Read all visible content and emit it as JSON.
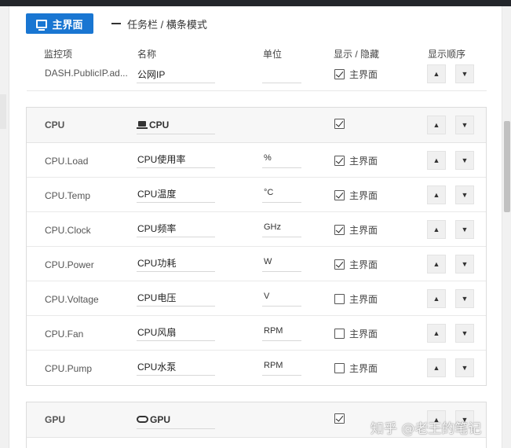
{
  "tabs": {
    "main_label": "主界面",
    "taskbar_label": "任务栏 / 横条模式"
  },
  "columns": {
    "key": "监控项",
    "name": "名称",
    "unit": "单位",
    "show": "显示 / 隐藏",
    "order": "显示顺序"
  },
  "partial_row": {
    "key": "DASH.PublicIP.ad...",
    "name": "公网IP",
    "unit": "",
    "checked": true,
    "show_label": "主界面"
  },
  "cpu_group": {
    "key": "CPU",
    "name": "CPU",
    "checked": true,
    "rows": [
      {
        "key": "CPU.Load",
        "name": "CPU使用率",
        "unit": "%",
        "checked": true,
        "show_label": "主界面"
      },
      {
        "key": "CPU.Temp",
        "name": "CPU温度",
        "unit": "°C",
        "checked": true,
        "show_label": "主界面"
      },
      {
        "key": "CPU.Clock",
        "name": "CPU频率",
        "unit": "GHz",
        "checked": true,
        "show_label": "主界面"
      },
      {
        "key": "CPU.Power",
        "name": "CPU功耗",
        "unit": "W",
        "checked": true,
        "show_label": "主界面"
      },
      {
        "key": "CPU.Voltage",
        "name": "CPU电压",
        "unit": "V",
        "checked": false,
        "show_label": "主界面"
      },
      {
        "key": "CPU.Fan",
        "name": "CPU风扇",
        "unit": " RPM",
        "checked": false,
        "show_label": "主界面"
      },
      {
        "key": "CPU.Pump",
        "name": "CPU水泵",
        "unit": " RPM",
        "checked": false,
        "show_label": "主界面"
      }
    ]
  },
  "gpu_group": {
    "key": "GPU",
    "name": "GPU",
    "checked": true
  },
  "buttons": {
    "up": "▲",
    "down": "▼"
  },
  "icons": {
    "main_tab": "monitor-icon",
    "cpu": "laptop-icon",
    "gpu": "gamepad-icon"
  },
  "watermark": "知乎 @老王的笔记",
  "colors": {
    "accent": "#1976d2",
    "topbar": "#23262b",
    "group_header_bg": "#f7f7f7"
  }
}
